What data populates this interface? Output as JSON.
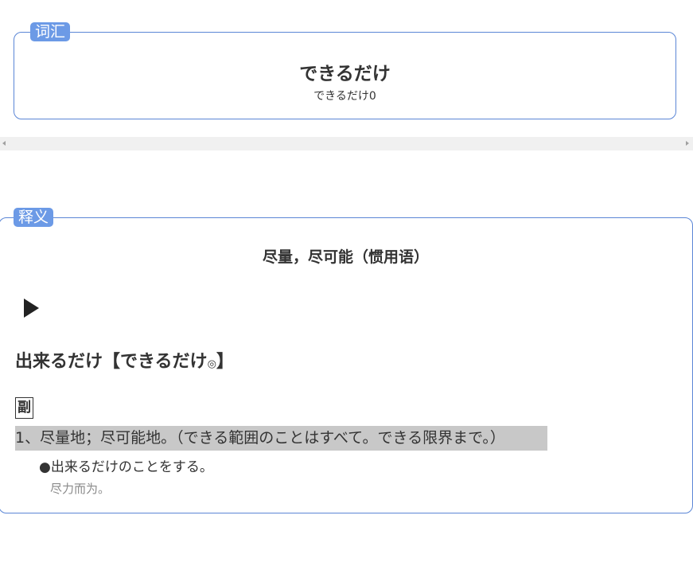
{
  "vocab": {
    "tag": "词汇",
    "word": "できるだけ",
    "reading": "できるだけ0"
  },
  "definition": {
    "tag": "释义",
    "summary": "尽量，尽可能（惯用语）",
    "play_icon": "play-icon",
    "headword": "出来るだけ【できるだけ",
    "accent_mark": "◎",
    "headword_close": "】",
    "part_of_speech": "副",
    "sense": "1、尽量地；尽可能地。（できる範囲のことはすべて。できる限界まで。）",
    "example_jp": "●出来るだけのことをする。",
    "example_cn": "尽力而为。"
  },
  "colors": {
    "tag_bg": "#6c9ae6",
    "border": "#5b86d6",
    "highlight": "#c8c8c8"
  }
}
